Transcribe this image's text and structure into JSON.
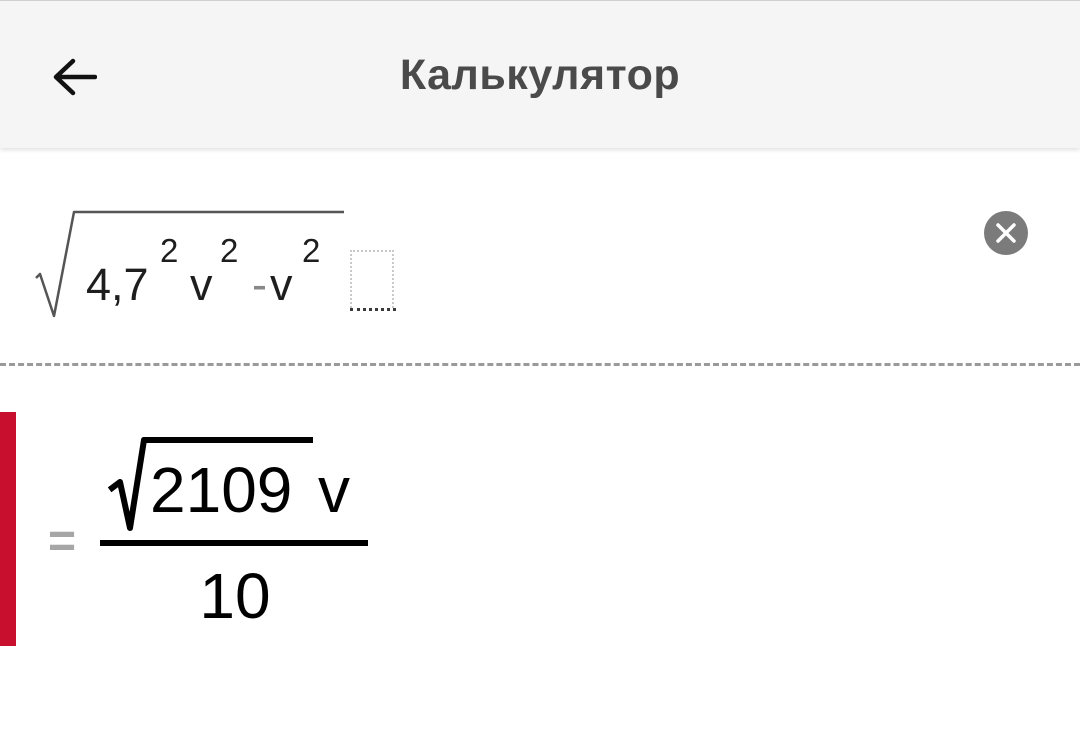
{
  "header": {
    "title": "Калькулятор",
    "back_icon": "arrow-left-icon"
  },
  "input": {
    "radicand": {
      "term1_base": "4,7",
      "term1_exp": "2",
      "term1_var": "v",
      "term1_var_exp": "2",
      "operator": "-",
      "term2_var": "v",
      "term2_var_exp": "2"
    },
    "sqrt_icon": "square-root-icon",
    "placeholder_icon": "empty-slot-icon",
    "clear_icon": "close-icon"
  },
  "result": {
    "equals": "=",
    "numerator_radicand": "2109",
    "numerator_var": "v",
    "denominator": "10",
    "accent_color": "#c8102e"
  },
  "colors": {
    "header_bg": "#f5f5f5",
    "title": "#4a4a4a",
    "clear_button_bg": "#7b7b7b",
    "accent": "#c8102e",
    "equals": "#a6a6a6"
  }
}
